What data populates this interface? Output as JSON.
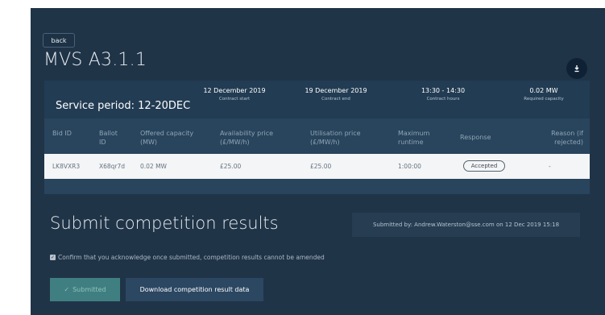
{
  "nav": {
    "back_label": "back"
  },
  "page": {
    "title": "MVS A3.1.1",
    "download_icon": "download-icon"
  },
  "summary": {
    "service_period": "Service period: 12-20DEC",
    "contract_start": {
      "value": "12 December 2019",
      "label": "Contract start"
    },
    "contract_end": {
      "value": "19 December 2019",
      "label": "Contract end"
    },
    "contract_hours": {
      "value": "13:30 - 14:30",
      "label": "Contract hours"
    },
    "required_capacity": {
      "value": "0.02 MW",
      "label": "Required capacity"
    }
  },
  "table": {
    "headers": {
      "bid_id": "Bid ID",
      "ballot_id": "Ballot ID",
      "offered_capacity": "Offered capacity (MW)",
      "availability_price": "Availability price (£/MW/h)",
      "utilisation_price": "Utilisation price (£/MW/h)",
      "maximum_runtime": "Maximum runtime",
      "response": "Response",
      "reason": "Reason (if rejected)"
    },
    "rows": [
      {
        "bid_id": "LK8VXR3",
        "ballot_id": "X68qr7d",
        "offered_capacity": "0.02 MW",
        "availability_price": "£25.00",
        "utilisation_price": "£25.00",
        "maximum_runtime": "1:00:00",
        "response": "Accepted",
        "reason": "-"
      }
    ]
  },
  "submit_section": {
    "title": "Submit competition results",
    "submitted_by": "Submitted by: Andrew.Waterston@sse.com on 12 Dec 2019 15:18",
    "confirm_text": "Confirm that you acknowledge once submitted, competition results cannot be amended",
    "confirm_checked": true,
    "submitted_button": "Submitted",
    "submitted_check_icon": "checkmark-icon",
    "download_button": "Download competition result data"
  },
  "colors": {
    "background": "#203448",
    "panel": "#28455d",
    "row_background": "#f4f5f6",
    "submitted_button": "#3f7f82",
    "download_button": "#2b4762"
  }
}
